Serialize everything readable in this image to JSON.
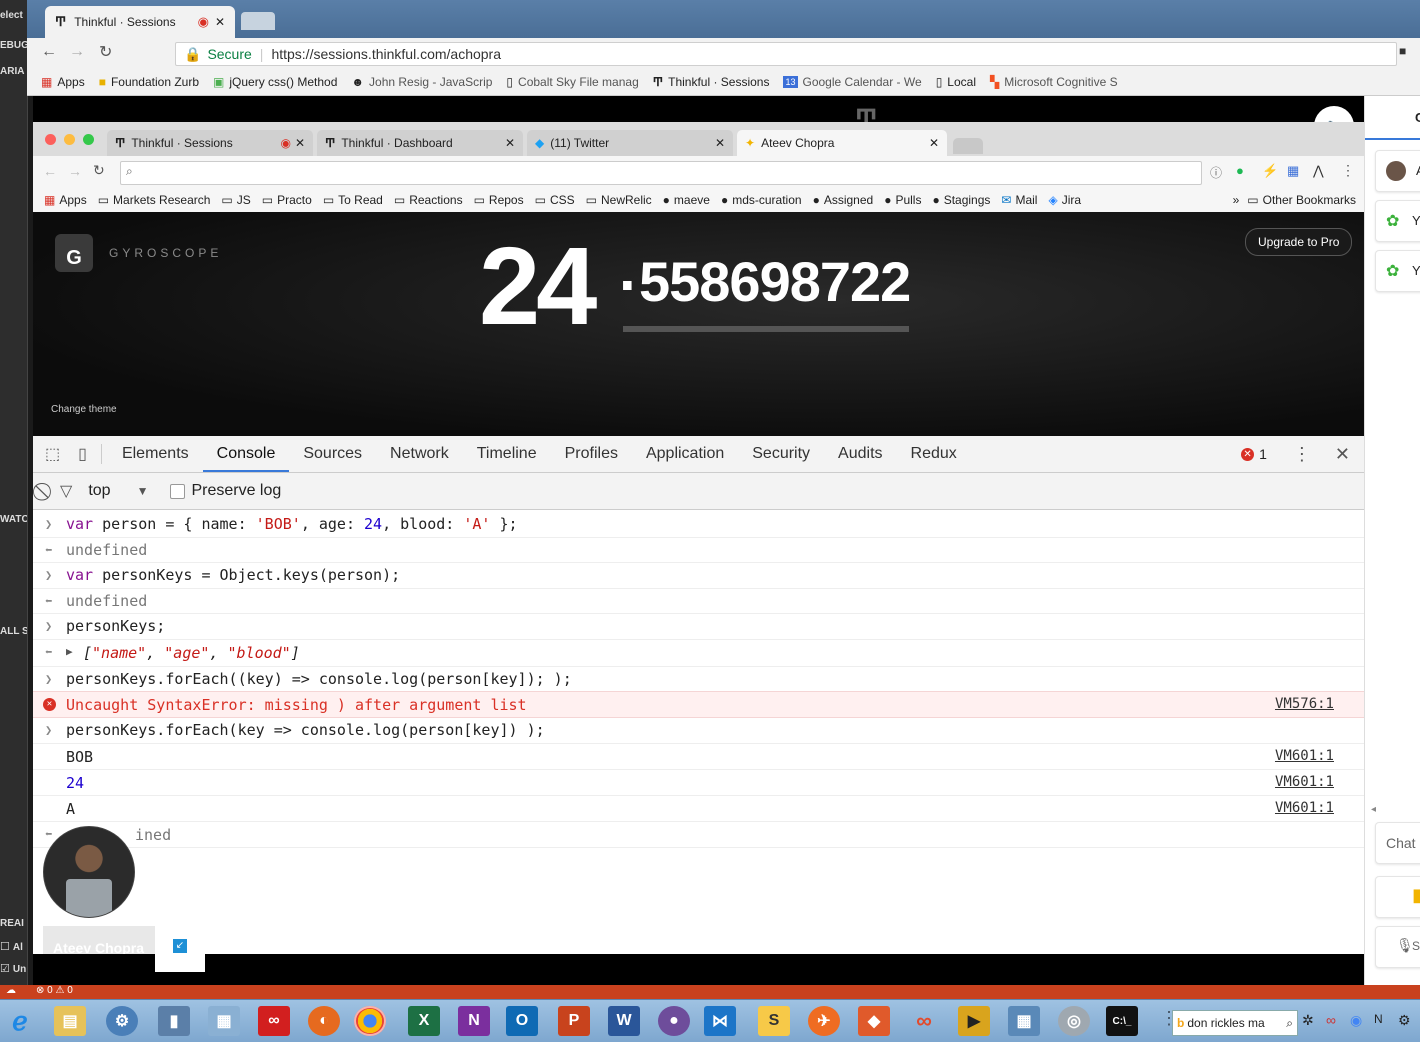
{
  "left_strip": [
    "elect",
    "EBUG",
    "ARIA",
    "WATC",
    "ALL S",
    "REAI",
    "Al",
    "Un"
  ],
  "outer_browser": {
    "tab_title": "Thinkful · Sessions",
    "secure_label": "Secure",
    "url": "https://sessions.thinkful.com/achopra",
    "bookmarks": [
      "Apps",
      "Foundation Zurb",
      "jQuery css() Method",
      "John Resig - JavaScrip",
      "Cobalt Sky File manag",
      "Thinkful · Sessions",
      "Google Calendar - We",
      "Local",
      "Microsoft Cognitive S"
    ],
    "calendar_badge": "13"
  },
  "right_panel": {
    "items": [
      "A",
      "Yo",
      "Yo"
    ],
    "header_letter": "C",
    "chat_label": "Chat",
    "mic_label": "S"
  },
  "inner_browser": {
    "tabs": [
      "Thinkful · Sessions",
      "Thinkful · Dashboard",
      "(11) Twitter",
      "Ateev Chopra"
    ],
    "active_tab_index": 3,
    "bookmarks": [
      "Apps",
      "Markets Research",
      "JS",
      "Practo",
      "To Read",
      "Reactions",
      "Repos",
      "CSS",
      "NewRelic",
      "maeve",
      "mds-curation",
      "Assigned",
      "Pulls",
      "Stagings",
      "Mail",
      "Jira"
    ],
    "overflow": "»",
    "other_bookmarks": "Other Bookmarks"
  },
  "gyroscope": {
    "logo_letter": "G",
    "brand": "GYROSCOPE",
    "integer": "24",
    "dot": ".",
    "decimals": "558698722",
    "upgrade_label": "Upgrade to Pro",
    "change_theme": "Change theme"
  },
  "devtools": {
    "tabs": [
      "Elements",
      "Console",
      "Sources",
      "Network",
      "Timeline",
      "Profiles",
      "Application",
      "Security",
      "Audits",
      "Redux"
    ],
    "active_tab": "Console",
    "error_count": "1",
    "context": "top",
    "preserve_log": "Preserve log",
    "preserve_log_checked": false
  },
  "console": {
    "l1": {
      "kw": "var",
      "a": " person = { name: ",
      "s1": "'BOB'",
      "b": ", age: ",
      "n1": "24",
      "c": ", blood: ",
      "s2": "'A'",
      "d": "  };"
    },
    "l2": "undefined",
    "l3": {
      "kw": "var",
      "rest": " personKeys = Object.keys(person);"
    },
    "l4": "undefined",
    "l5": "personKeys;",
    "l6": {
      "open": "[",
      "s1": "\"name\"",
      "sep1": ", ",
      "s2": "\"age\"",
      "sep2": ", ",
      "s3": "\"blood\"",
      "close": "]"
    },
    "l7": "personKeys.forEach((key) => console.log(person[key]); );",
    "l8": {
      "text": "Uncaught SyntaxError: missing ) after argument list",
      "source": "VM576:1"
    },
    "l9": "personKeys.forEach(key => console.log(person[key]) );",
    "out1": {
      "text": "BOB",
      "source": "VM601:1"
    },
    "out2": {
      "text": "24",
      "source": "VM601:1"
    },
    "out3": {
      "text": "A",
      "source": "VM601:1"
    },
    "l13": "ined"
  },
  "presenter": {
    "name": "Ateev Chopra"
  },
  "statusbar": {
    "errors": "0",
    "warnings": "0"
  },
  "taskbar": {
    "search_text": "don rickles ma",
    "icons": [
      "ie-icon",
      "explorer-icon",
      "network-icon",
      "media-icon",
      "calculator-icon",
      "creative-cloud-icon",
      "firefox-icon",
      "chrome-icon",
      "excel-icon",
      "onenote-icon",
      "outlook-icon",
      "powerpoint-icon",
      "word-icon",
      "github-icon",
      "vscode-icon",
      "sublime-icon",
      "postman-icon",
      "sourcetree-icon",
      "infinity-icon",
      "plex-icon",
      "remote-icon",
      "webcam-icon",
      "terminal-icon"
    ],
    "excel_label": "X",
    "onenote_label": "N",
    "outlook_label": "O",
    "powerpoint_label": "P",
    "word_label": "W",
    "terminal_label": "C:\\_"
  },
  "colors": {
    "accent": "#3879d9",
    "error": "#d93025",
    "statusbar": "#c9411e"
  }
}
